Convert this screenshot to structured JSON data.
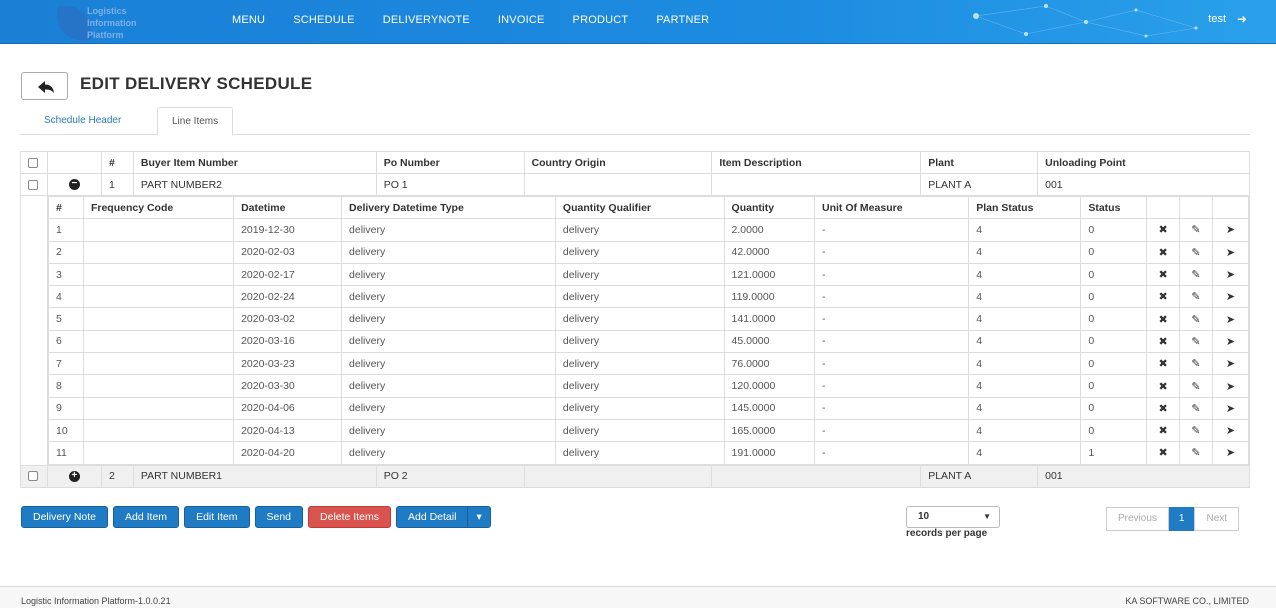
{
  "brand": {
    "logo_text": "Logistics Information Platform"
  },
  "nav": [
    "MENU",
    "SCHEDULE",
    "DELIVERYNOTE",
    "INVOICE",
    "PRODUCT",
    "PARTNER"
  ],
  "user": {
    "name": "test"
  },
  "page": {
    "title": "EDIT DELIVERY SCHEDULE"
  },
  "tabs": [
    {
      "label": "Schedule Header",
      "active": false
    },
    {
      "label": "Line Items",
      "active": true
    }
  ],
  "items_table": {
    "headers": [
      "#",
      "Buyer Item Number",
      "Po Number",
      "Country Origin",
      "Item Description",
      "Plant",
      "Unloading Point"
    ],
    "rows": [
      {
        "num": "1",
        "buyer_item": "PART NUMBER2",
        "po": "PO 1",
        "country": "",
        "description": "",
        "plant": "PLANT A",
        "unloading": "001",
        "expanded": true
      },
      {
        "num": "2",
        "buyer_item": "PART NUMBER1",
        "po": "PO 2",
        "country": "",
        "description": "",
        "plant": "PLANT A",
        "unloading": "001",
        "expanded": false
      }
    ]
  },
  "detail_table": {
    "headers": [
      "#",
      "Frequency Code",
      "Datetime",
      "Delivery Datetime Type",
      "Quantity Qualifier",
      "Quantity",
      "Unit Of Measure",
      "Plan Status",
      "Status"
    ],
    "rows": [
      [
        "1",
        "",
        "2019-12-30",
        "delivery",
        "delivery",
        "2.0000",
        "-",
        "4",
        "0"
      ],
      [
        "2",
        "",
        "2020-02-03",
        "delivery",
        "delivery",
        "42.0000",
        "-",
        "4",
        "0"
      ],
      [
        "3",
        "",
        "2020-02-17",
        "delivery",
        "delivery",
        "121.0000",
        "-",
        "4",
        "0"
      ],
      [
        "4",
        "",
        "2020-02-24",
        "delivery",
        "delivery",
        "119.0000",
        "-",
        "4",
        "0"
      ],
      [
        "5",
        "",
        "2020-03-02",
        "delivery",
        "delivery",
        "141.0000",
        "-",
        "4",
        "0"
      ],
      [
        "6",
        "",
        "2020-03-16",
        "delivery",
        "delivery",
        "45.0000",
        "-",
        "4",
        "0"
      ],
      [
        "7",
        "",
        "2020-03-23",
        "delivery",
        "delivery",
        "76.0000",
        "-",
        "4",
        "0"
      ],
      [
        "8",
        "",
        "2020-03-30",
        "delivery",
        "delivery",
        "120.0000",
        "-",
        "4",
        "0"
      ],
      [
        "9",
        "",
        "2020-04-06",
        "delivery",
        "delivery",
        "145.0000",
        "-",
        "4",
        "0"
      ],
      [
        "10",
        "",
        "2020-04-13",
        "delivery",
        "delivery",
        "165.0000",
        "-",
        "4",
        "0"
      ],
      [
        "11",
        "",
        "2020-04-20",
        "delivery",
        "delivery",
        "191.0000",
        "-",
        "4",
        "1"
      ]
    ],
    "row_actions": [
      "delete-icon",
      "edit-icon",
      "send-icon"
    ]
  },
  "actions": {
    "delivery_note": "Delivery Note",
    "add_item": "Add Item",
    "edit_item": "Edit Item",
    "send": "Send",
    "delete_items": "Delete Items",
    "add_detail": "Add Detail"
  },
  "pagination": {
    "page_size": "10",
    "records_per_page": "records per page",
    "previous": "Previous",
    "current": "1",
    "next": "Next"
  },
  "footer": {
    "left": "Logistic Information Platform-1.0.0.21",
    "right": "KA SOFTWARE CO., LIMITED"
  },
  "colors": {
    "header": "#1c8be0",
    "primary": "#1f7cc4",
    "danger": "#d9534f"
  }
}
